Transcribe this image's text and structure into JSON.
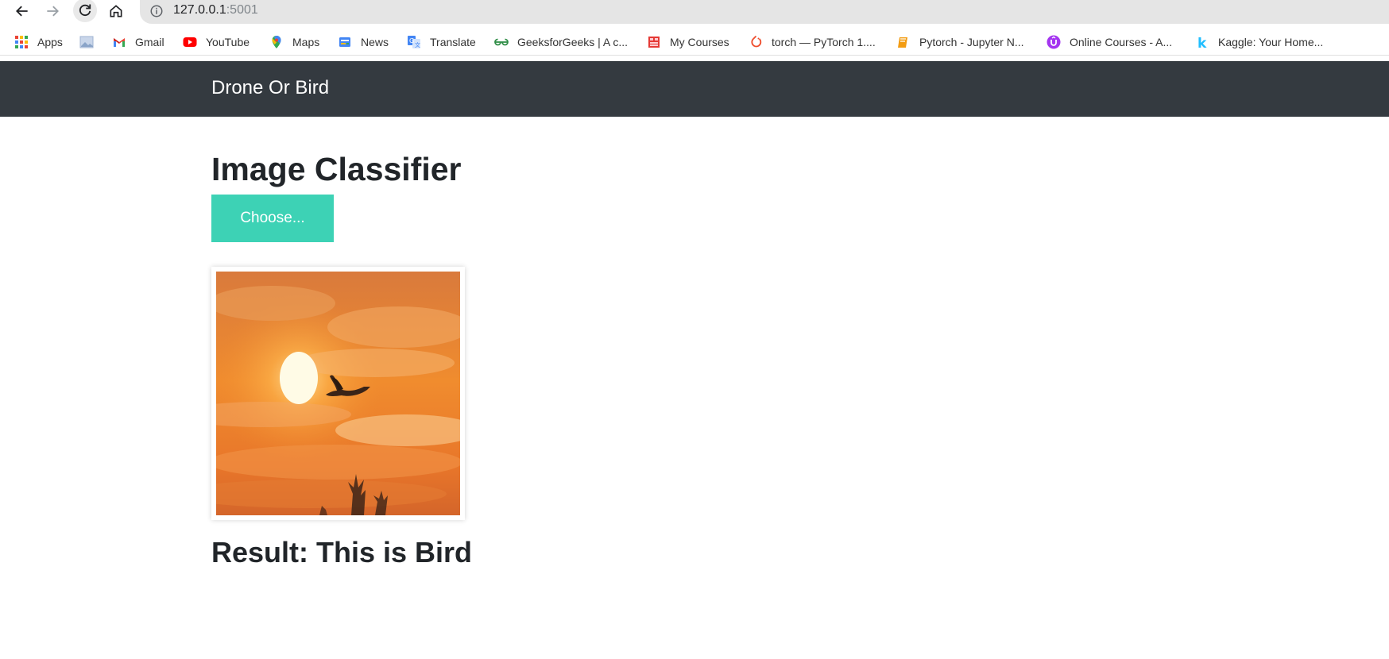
{
  "browser": {
    "url_host": "127.0.0.1",
    "url_port": ":5001",
    "bookmarks": [
      {
        "label": "Apps",
        "icon": "apps-grid-icon"
      },
      {
        "label": "",
        "icon": "image-icon"
      },
      {
        "label": "Gmail",
        "icon": "gmail-icon"
      },
      {
        "label": "YouTube",
        "icon": "youtube-icon"
      },
      {
        "label": "Maps",
        "icon": "maps-pin-icon"
      },
      {
        "label": "News",
        "icon": "news-icon"
      },
      {
        "label": "Translate",
        "icon": "translate-icon"
      },
      {
        "label": "GeeksforGeeks | A c...",
        "icon": "geeksforgeeks-icon"
      },
      {
        "label": "My Courses",
        "icon": "courses-icon"
      },
      {
        "label": "torch — PyTorch 1....",
        "icon": "pytorch-icon"
      },
      {
        "label": "Pytorch - Jupyter N...",
        "icon": "jupyter-book-icon"
      },
      {
        "label": "Online Courses - A...",
        "icon": "udemy-icon"
      },
      {
        "label": "Kaggle: Your Home...",
        "icon": "kaggle-icon"
      }
    ]
  },
  "navbar": {
    "brand": "Drone Or Bird",
    "bg_color": "#343a40"
  },
  "main": {
    "title": "Image Classifier",
    "choose_label": "Choose...",
    "accent_color": "#3dd2b5",
    "result_text": "Result: This is Bird"
  }
}
